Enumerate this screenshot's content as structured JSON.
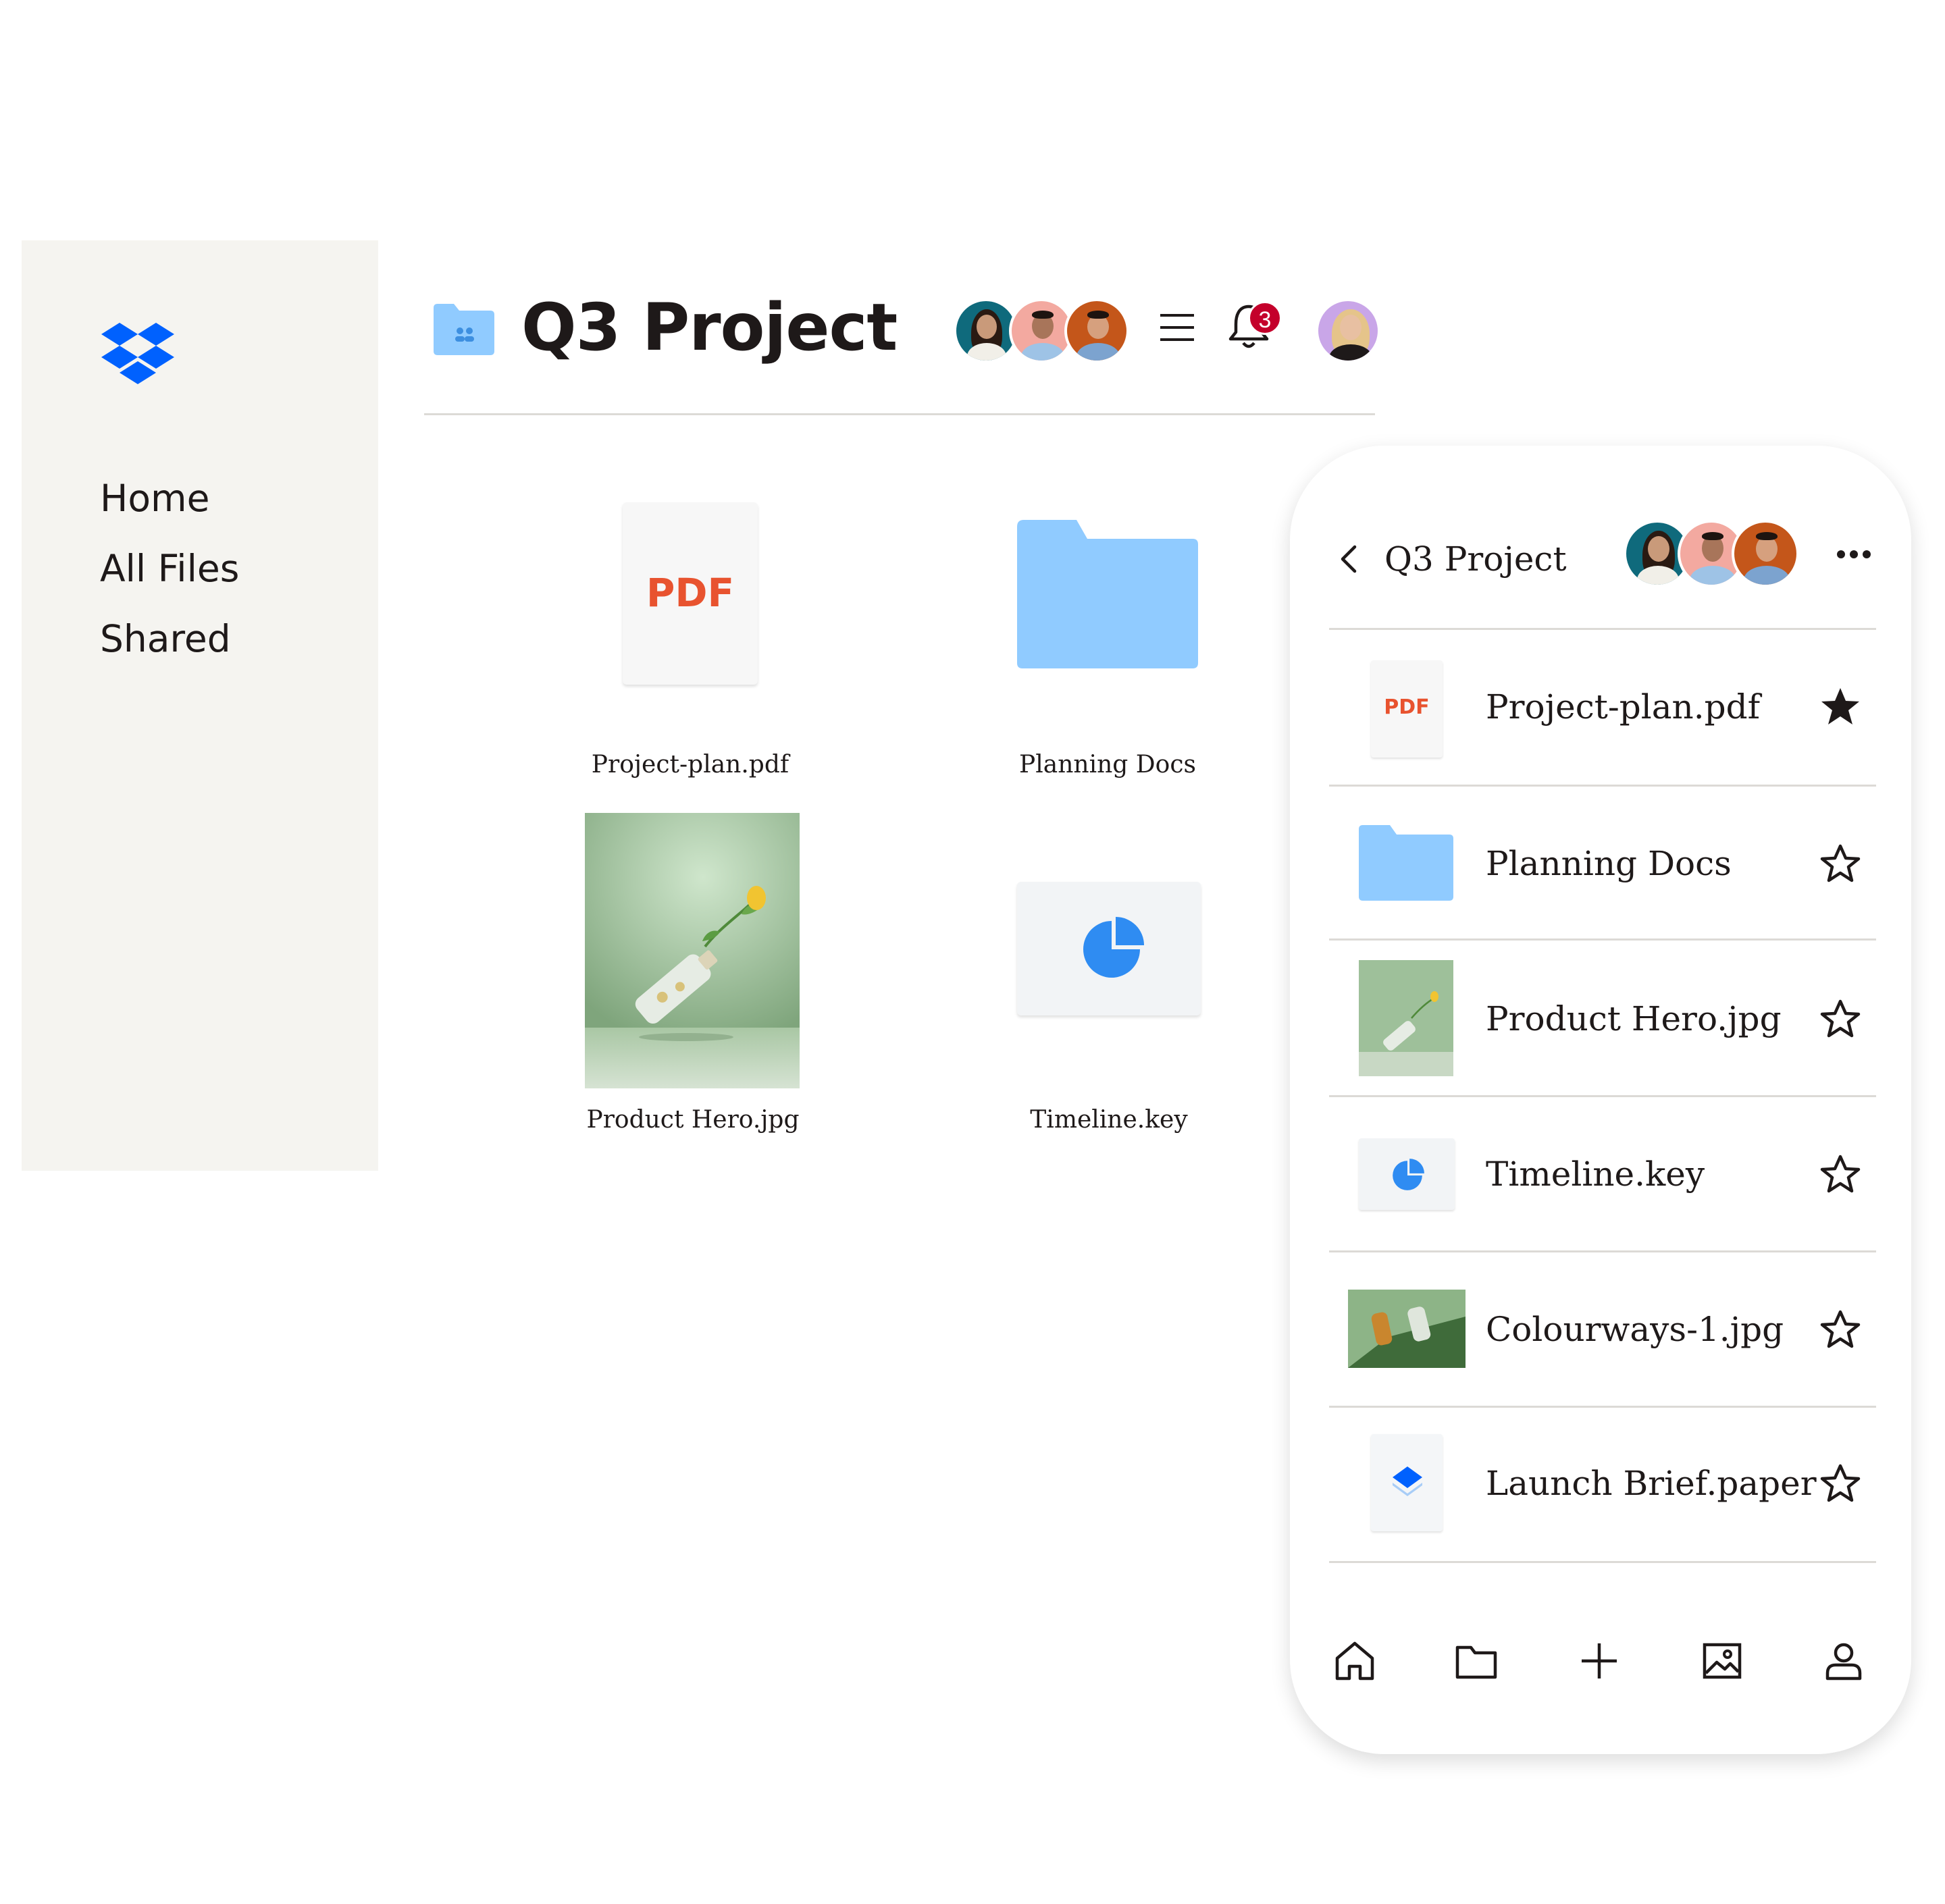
{
  "sidebar": {
    "nav": [
      {
        "label": "Home"
      },
      {
        "label": "All Files"
      },
      {
        "label": "Shared"
      }
    ]
  },
  "header": {
    "title": "Q3 Project",
    "notification_count": "3"
  },
  "files": [
    {
      "name": "Project-plan.pdf",
      "thumb_label": "PDF",
      "type": "pdf"
    },
    {
      "name": "Planning Docs",
      "type": "folder"
    },
    {
      "name": "Product Hero.jpg",
      "type": "image"
    },
    {
      "name": "Timeline.key",
      "type": "keynote"
    }
  ],
  "mobile": {
    "title": "Q3 Project",
    "rows": [
      {
        "name": "Project-plan.pdf",
        "thumb_label": "PDF",
        "starred": true
      },
      {
        "name": "Planning Docs",
        "starred": false
      },
      {
        "name": "Product Hero.jpg",
        "starred": false
      },
      {
        "name": "Timeline.key",
        "starred": false
      },
      {
        "name": "Colourways-1.jpg",
        "starred": false
      },
      {
        "name": "Launch Brief.paper",
        "starred": false
      }
    ],
    "bottom_nav": [
      "home-icon",
      "folder-icon",
      "plus-icon",
      "photos-icon",
      "account-icon"
    ]
  },
  "colors": {
    "accent": "#0061fe",
    "folder": "#90cbff",
    "pdf_red": "#e8532f",
    "badge": "#c4002b",
    "sidebar_bg": "#f5f4f0"
  }
}
